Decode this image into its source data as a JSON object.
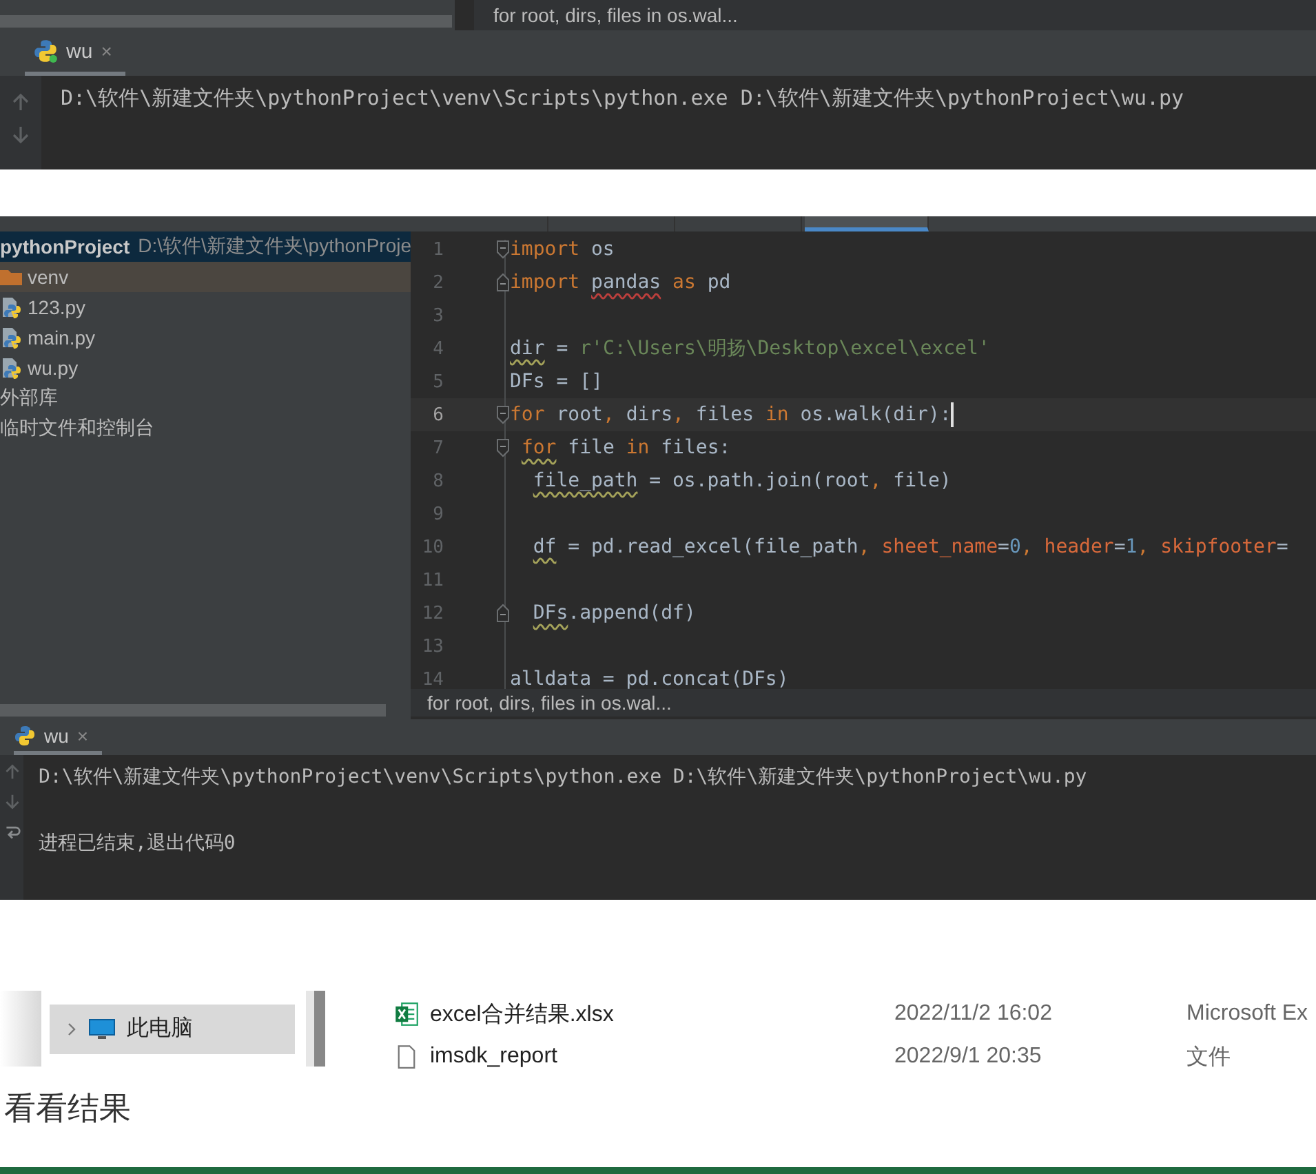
{
  "top_snippet": {
    "breadcrumb": "for root, dirs, files in os.wal...",
    "run_tab": {
      "label": "wu",
      "close": "×"
    },
    "console": [
      "D:\\软件\\新建文件夹\\pythonProject\\venv\\Scripts\\python.exe D:\\软件\\新建文件夹\\pythonProject\\wu.py"
    ]
  },
  "ide": {
    "editor_tabs": [
      {
        "selected": false
      },
      {
        "selected": false
      },
      {
        "selected": false
      },
      {
        "selected": true
      }
    ],
    "project": {
      "root": {
        "name": "pythonProject",
        "path": "D:\\软件\\新建文件夹\\pythonProje"
      },
      "items": [
        {
          "label": "venv",
          "kind": "folder",
          "selected": true
        },
        {
          "label": "123.py",
          "kind": "python",
          "selected": false
        },
        {
          "label": "main.py",
          "kind": "python",
          "selected": false
        },
        {
          "label": "wu.py",
          "kind": "python",
          "selected": false
        },
        {
          "label": "外部库",
          "kind": "library",
          "selected": false
        },
        {
          "label": "临时文件和控制台",
          "kind": "library",
          "selected": false
        }
      ]
    },
    "editor": {
      "lines": [
        {
          "number": "1",
          "kind": "fold_start",
          "current": false,
          "tokens": [
            {
              "kind": "keyword",
              "t": "import"
            },
            {
              "kind": "name",
              "t": " os"
            }
          ]
        },
        {
          "number": "2",
          "kind": "fold_end",
          "current": false,
          "tokens": [
            {
              "kind": "keyword",
              "t": "import "
            },
            {
              "kind": "error_name",
              "t": "pandas"
            },
            {
              "kind": "keyword",
              "t": " as"
            },
            {
              "kind": "name",
              "t": " pd"
            }
          ]
        },
        {
          "number": "3",
          "kind": "plain",
          "current": false
        },
        {
          "number": "4",
          "kind": "plain",
          "current": false,
          "tokens": [
            {
              "kind": "warn_name",
              "t": "dir"
            },
            {
              "kind": "name",
              "t": " = "
            },
            {
              "kind": "string",
              "t": "r'C:\\Users\\明扬\\Desktop\\excel\\excel'"
            }
          ]
        },
        {
          "number": "5",
          "kind": "plain",
          "current": false,
          "tokens": [
            {
              "kind": "name",
              "t": "DFs = []"
            }
          ]
        },
        {
          "number": "6",
          "kind": "fold_start",
          "current": true,
          "tokens": [
            {
              "kind": "keyword",
              "t": "for"
            },
            {
              "kind": "name",
              "t": " root"
            },
            {
              "kind": "keyword",
              "t": ", "
            },
            {
              "kind": "name",
              "t": "dirs"
            },
            {
              "kind": "keyword",
              "t": ", "
            },
            {
              "kind": "name",
              "t": "files "
            },
            {
              "kind": "keyword",
              "t": "in"
            },
            {
              "kind": "name",
              "t": " os.walk(dir):"
            }
          ]
        },
        {
          "number": "7",
          "kind": "fold_start",
          "current": false,
          "tokens": [
            {
              "kind": "warn_keyword",
              "t": " for"
            },
            {
              "kind": "name",
              "t": " file "
            },
            {
              "kind": "keyword",
              "t": "in"
            },
            {
              "kind": "name",
              "t": " files:"
            }
          ]
        },
        {
          "number": "8",
          "kind": "plain",
          "current": false,
          "tokens": [
            {
              "kind": "warn_name",
              "t": "  file_path"
            },
            {
              "kind": "name",
              "t": " = os.path.join(root"
            },
            {
              "kind": "keyword",
              "t": ", "
            },
            {
              "kind": "name",
              "t": "file)"
            }
          ]
        },
        {
          "number": "9",
          "kind": "plain",
          "current": false
        },
        {
          "number": "10",
          "kind": "plain",
          "current": false,
          "tokens": [
            {
              "kind": "warn_name",
              "t": "  df"
            },
            {
              "kind": "name",
              "t": " = pd.read_excel(file_path"
            },
            {
              "kind": "keyword",
              "t": ", "
            },
            {
              "kind": "param",
              "t": "sheet_name"
            },
            {
              "kind": "name",
              "t": "="
            },
            {
              "kind": "number",
              "t": "0"
            },
            {
              "kind": "keyword",
              "t": ", "
            },
            {
              "kind": "param",
              "t": "header"
            },
            {
              "kind": "name",
              "t": "="
            },
            {
              "kind": "number",
              "t": "1"
            },
            {
              "kind": "keyword",
              "t": ", "
            },
            {
              "kind": "param",
              "t": "skipfooter"
            },
            {
              "kind": "name",
              "t": "="
            }
          ]
        },
        {
          "number": "11",
          "kind": "plain",
          "current": false
        },
        {
          "number": "12",
          "kind": "fold_end",
          "current": false,
          "tokens": [
            {
              "kind": "warn_name",
              "t": "  DFs"
            },
            {
              "kind": "name",
              "t": ".append(df)"
            }
          ]
        },
        {
          "number": "13",
          "kind": "plain",
          "current": false
        },
        {
          "number": "14",
          "kind": "plain",
          "current": false,
          "tokens": [
            {
              "kind": "name",
              "t": "alldata = pd.concat(DFs)"
            }
          ]
        }
      ]
    },
    "breadcrumb": "for root, dirs, files in os.wal...",
    "run": {
      "tab": {
        "label": "wu",
        "close": "×"
      },
      "console": [
        {
          "kind": "command",
          "text": "D:\\软件\\新建文件夹\\pythonProject\\venv\\Scripts\\python.exe D:\\软件\\新建文件夹\\pythonProject\\wu.py"
        },
        {
          "kind": "exit",
          "text": "进程已结束,退出代码0"
        }
      ]
    }
  },
  "explorer": {
    "nav": {
      "label": "此电脑",
      "selected": true
    },
    "files": [
      {
        "kind": "excel",
        "name": "excel合并结果.xlsx",
        "date": "2022/11/2 16:02",
        "type": "Microsoft Ex"
      },
      {
        "kind": "file",
        "name": "imsdk_report",
        "date": "2022/9/1 20:35",
        "type": "文件"
      }
    ]
  },
  "caption": "看看结果"
}
